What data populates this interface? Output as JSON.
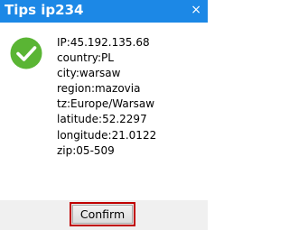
{
  "window": {
    "title": "Tips ip234",
    "close_glyph": "×"
  },
  "icon": {
    "name": "check-circle-icon",
    "color": "#5ab534"
  },
  "info": [
    "IP:45.192.135.68",
    "country:PL",
    "city:warsaw",
    "region:mazovia",
    "tz:Europe/Warsaw",
    "latitude:52.2297",
    "longitude:21.0122",
    "zip:05-509"
  ],
  "footer": {
    "confirm_label": "Confirm"
  }
}
